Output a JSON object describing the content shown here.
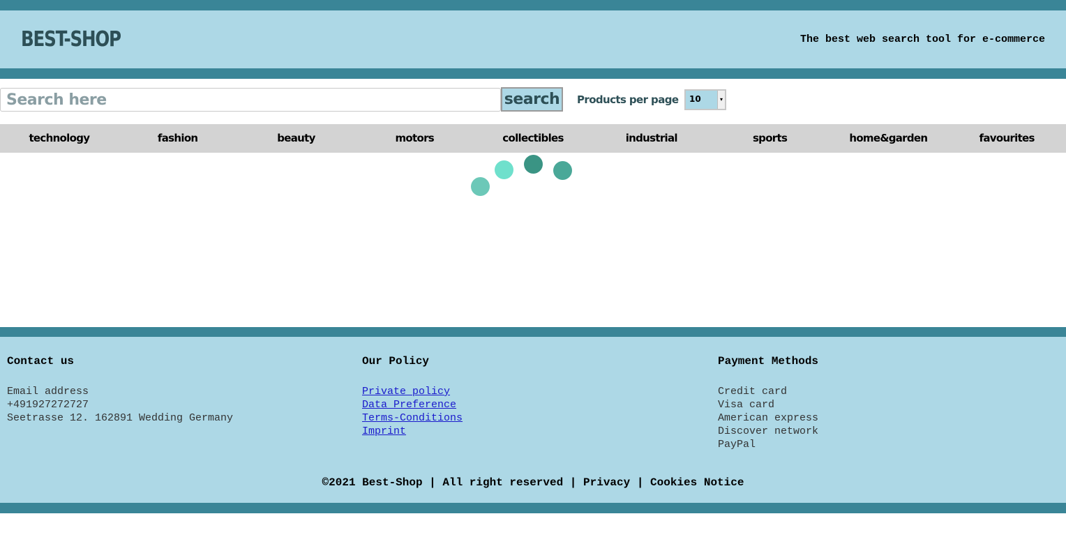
{
  "header": {
    "logo": "BEST-SHOP",
    "tagline": "The best web search tool for e-commerce"
  },
  "search": {
    "placeholder": "Search here",
    "value": "",
    "button_label": "search",
    "per_page_label": "Products per page",
    "per_page_value": "10"
  },
  "nav": {
    "items": [
      {
        "label": "technology"
      },
      {
        "label": "fashion"
      },
      {
        "label": "beauty"
      },
      {
        "label": "motors"
      },
      {
        "label": "collectibles"
      },
      {
        "label": "industrial"
      },
      {
        "label": "sports"
      },
      {
        "label": "home&garden"
      },
      {
        "label": "favourites"
      }
    ]
  },
  "footer": {
    "contact": {
      "heading": "Contact us",
      "lines": [
        "Email address",
        "+491927272727",
        "Seetrasse 12. 162891 Wedding Germany"
      ]
    },
    "policy": {
      "heading": "Our Policy",
      "links": [
        "Private policy",
        "Data Preference",
        "Terms-Conditions",
        "Imprint"
      ]
    },
    "payment": {
      "heading": "Payment Methods",
      "methods": [
        "Credit card",
        "Visa card",
        "American express",
        "Discover network",
        "PayPal"
      ]
    },
    "copyright": "©2021 Best-Shop | All right reserved | Privacy | Cookies Notice"
  },
  "colors": {
    "band": "#3a8597",
    "header_bg": "#add8e6",
    "nav_bg": "#d3d3d3",
    "logo_text": "#2d4f56",
    "link": "#1a1acc",
    "spinner_1": "#6cc8b8",
    "spinner_2": "#6fe0cc",
    "spinner_3": "#3a9484",
    "spinner_4": "#4aa898"
  }
}
